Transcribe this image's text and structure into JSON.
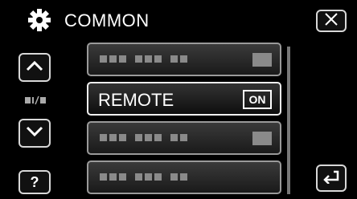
{
  "header": {
    "title": "COMMON",
    "icon": "gear-icon"
  },
  "close": {
    "icon": "close-icon"
  },
  "nav": {
    "up_icon": "chevron-up-icon",
    "down_icon": "chevron-down-icon",
    "mode_icon": "display-mode-icon",
    "help_label": "?"
  },
  "items": [
    {
      "label": "",
      "value": ""
    },
    {
      "label": "REMOTE",
      "value": "ON"
    },
    {
      "label": "",
      "value": ""
    },
    {
      "label": "",
      "value": ""
    }
  ],
  "back": {
    "icon": "return-icon"
  }
}
